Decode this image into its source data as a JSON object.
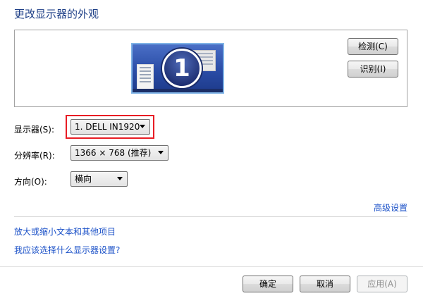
{
  "page_title": "更改显示器的外观",
  "preview": {
    "monitor_number": "1",
    "detect_button": "检测(C)",
    "identify_button": "识别(I)"
  },
  "settings": {
    "display_label": "显示器(S):",
    "display_value": "1. DELL IN1920",
    "resolution_label": "分辨率(R):",
    "resolution_value": "1366 × 768 (推荐)",
    "orientation_label": "方向(O):",
    "orientation_value": "横向"
  },
  "links": {
    "advanced_settings": "高级设置",
    "enlarge_text": "放大或缩小文本和其他项目",
    "which_settings": "我应该选择什么显示器设置?"
  },
  "footer": {
    "ok_button": "确定",
    "cancel_button": "取消",
    "apply_button": "应用(A)"
  },
  "colors": {
    "title": "#1e3f87",
    "link": "#1c52c8",
    "highlight_border": "#e81c24"
  }
}
